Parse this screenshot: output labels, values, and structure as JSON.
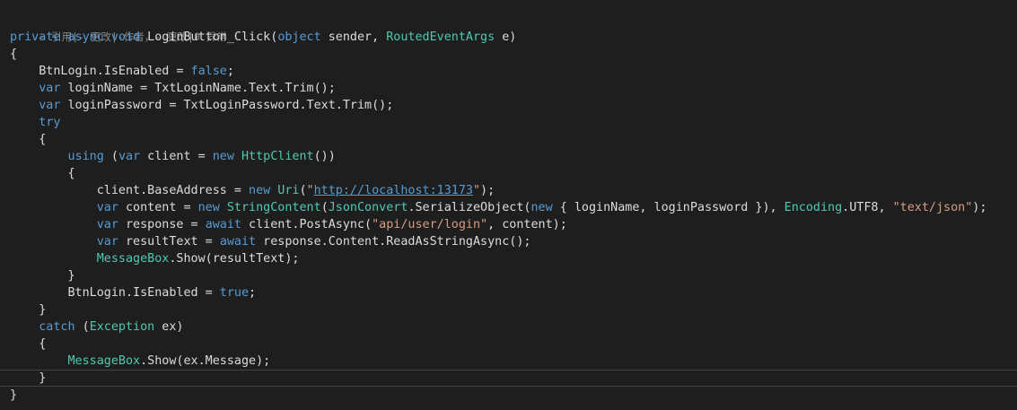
{
  "editor": {
    "codelens": "- 引用|- 更改|-作者，- 更改|0 异常",
    "current_line": 20,
    "colors": {
      "background": "#1e1e1e",
      "text": "#dcdcdc",
      "keyword": "#569cd6",
      "type": "#4ec9b0",
      "string": "#d69d85",
      "codelens": "#8a8a8a",
      "current_line_border": "#464646"
    },
    "lines": [
      [
        [
          "kw",
          "private"
        ],
        [
          "p",
          " "
        ],
        [
          "kw",
          "async"
        ],
        [
          "p",
          " "
        ],
        [
          "kw",
          "void"
        ],
        [
          "p",
          " LoginButton_Click("
        ],
        [
          "kw",
          "object"
        ],
        [
          "p",
          " sender, "
        ],
        [
          "ty",
          "RoutedEventArgs"
        ],
        [
          "p",
          " e)"
        ]
      ],
      [
        [
          "p",
          "{"
        ]
      ],
      [
        [
          "p",
          "    BtnLogin.IsEnabled = "
        ],
        [
          "kw",
          "false"
        ],
        [
          "p",
          ";"
        ]
      ],
      [
        [
          "p",
          "    "
        ],
        [
          "kw",
          "var"
        ],
        [
          "p",
          " loginName = TxtLoginName.Text.Trim();"
        ]
      ],
      [
        [
          "p",
          "    "
        ],
        [
          "kw",
          "var"
        ],
        [
          "p",
          " loginPassword = TxtLoginPassword.Text.Trim();"
        ]
      ],
      [
        [
          "p",
          "    "
        ],
        [
          "kw",
          "try"
        ]
      ],
      [
        [
          "p",
          "    {"
        ]
      ],
      [
        [
          "p",
          "        "
        ],
        [
          "kw",
          "using"
        ],
        [
          "p",
          " ("
        ],
        [
          "kw",
          "var"
        ],
        [
          "p",
          " client = "
        ],
        [
          "kw",
          "new"
        ],
        [
          "p",
          " "
        ],
        [
          "ty",
          "HttpClient"
        ],
        [
          "p",
          "())"
        ]
      ],
      [
        [
          "p",
          "        {"
        ]
      ],
      [
        [
          "p",
          "            client.BaseAddress = "
        ],
        [
          "kw",
          "new"
        ],
        [
          "p",
          " "
        ],
        [
          "ty",
          "Uri"
        ],
        [
          "p",
          "("
        ],
        [
          "str",
          "\""
        ],
        [
          "url",
          "http://localhost:13173"
        ],
        [
          "str",
          "\""
        ],
        [
          "p",
          ");"
        ]
      ],
      [
        [
          "p",
          "            "
        ],
        [
          "kw",
          "var"
        ],
        [
          "p",
          " content = "
        ],
        [
          "kw",
          "new"
        ],
        [
          "p",
          " "
        ],
        [
          "ty",
          "StringContent"
        ],
        [
          "p",
          "("
        ],
        [
          "ty",
          "JsonConvert"
        ],
        [
          "p",
          ".SerializeObject("
        ],
        [
          "kw",
          "new"
        ],
        [
          "p",
          " { loginName, loginPassword }), "
        ],
        [
          "ty",
          "Encoding"
        ],
        [
          "p",
          ".UTF8, "
        ],
        [
          "str",
          "\"text/json\""
        ],
        [
          "p",
          ");"
        ]
      ],
      [
        [
          "p",
          "            "
        ],
        [
          "kw",
          "var"
        ],
        [
          "p",
          " response = "
        ],
        [
          "kw",
          "await"
        ],
        [
          "p",
          " client.PostAsync("
        ],
        [
          "str",
          "\"api/user/login\""
        ],
        [
          "p",
          ", content);"
        ]
      ],
      [
        [
          "p",
          "            "
        ],
        [
          "kw",
          "var"
        ],
        [
          "p",
          " resultText = "
        ],
        [
          "kw",
          "await"
        ],
        [
          "p",
          " response.Content.ReadAsStringAsync();"
        ]
      ],
      [
        [
          "p",
          "            "
        ],
        [
          "ty",
          "MessageBox"
        ],
        [
          "p",
          ".Show(resultText);"
        ]
      ],
      [
        [
          "p",
          "        }"
        ]
      ],
      [
        [
          "p",
          "        BtnLogin.IsEnabled = "
        ],
        [
          "kw",
          "true"
        ],
        [
          "p",
          ";"
        ]
      ],
      [
        [
          "p",
          "    }"
        ]
      ],
      [
        [
          "p",
          "    "
        ],
        [
          "kw",
          "catch"
        ],
        [
          "p",
          " ("
        ],
        [
          "ty",
          "Exception"
        ],
        [
          "p",
          " ex)"
        ]
      ],
      [
        [
          "p",
          "    {"
        ]
      ],
      [
        [
          "p",
          "        "
        ],
        [
          "ty",
          "MessageBox"
        ],
        [
          "p",
          ".Show(ex.Message);"
        ]
      ],
      [
        [
          "p",
          "    }"
        ]
      ],
      [
        [
          "p",
          "}"
        ]
      ]
    ]
  }
}
